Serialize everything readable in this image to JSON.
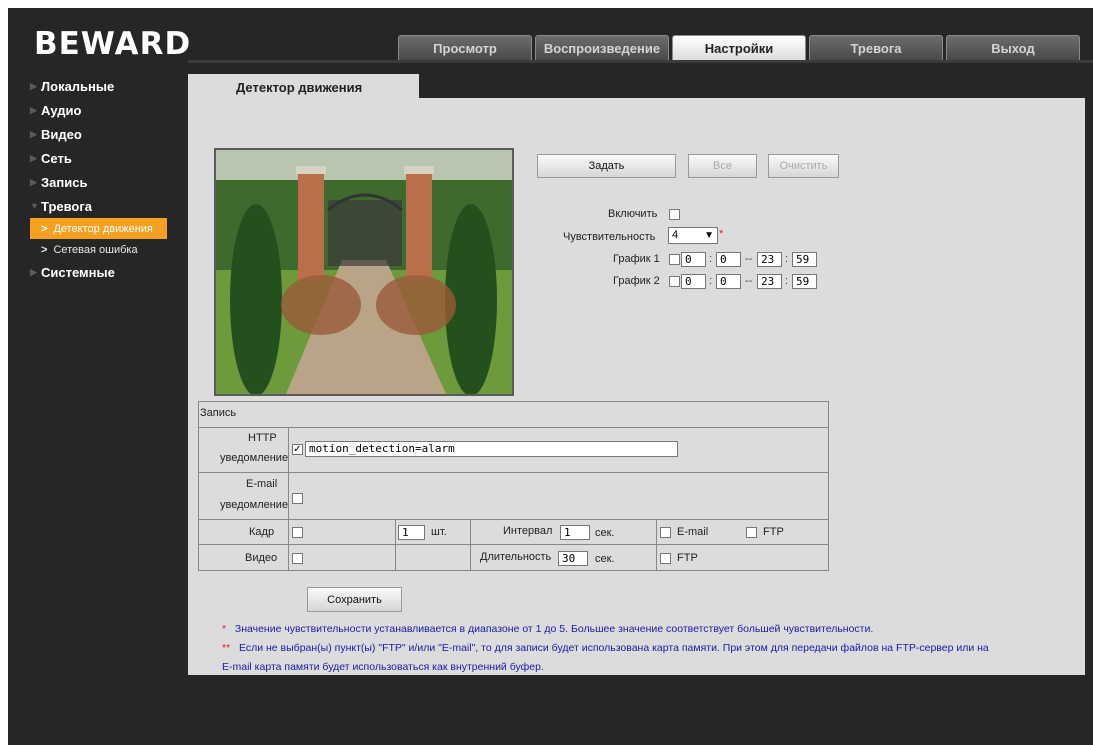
{
  "brand": "BEWARD",
  "tabs": [
    "Просмотр",
    "Воспроизведение",
    "Настройки",
    "Тревога",
    "Выход"
  ],
  "active_tab": 2,
  "sidebar": {
    "items": [
      {
        "label": "Локальные"
      },
      {
        "label": "Аудио"
      },
      {
        "label": "Видео"
      },
      {
        "label": "Сеть"
      },
      {
        "label": "Запись"
      },
      {
        "label": "Тревога",
        "expanded": true
      },
      {
        "label": "Системные"
      }
    ],
    "subitems": [
      {
        "label": "Детектор движения",
        "active": true
      },
      {
        "label": "Сетевая ошибка"
      }
    ]
  },
  "content_tab": "Детектор движения",
  "buttons": {
    "set": "Задать",
    "all": "Все",
    "clear": "Очистить",
    "save": "Сохранить"
  },
  "settings": {
    "enable_label": "Включить",
    "sensitivity_label": "Чувствительность",
    "sensitivity_value": "4",
    "schedule1_label": "График 1",
    "schedule1": {
      "h1": "0",
      "m1": "0",
      "h2": "23",
      "m2": "59"
    },
    "schedule2_label": "График 2",
    "schedule2": {
      "h1": "0",
      "m1": "0",
      "h2": "23",
      "m2": "59"
    }
  },
  "record": {
    "title": "Запись",
    "http_label_1": "HTTP",
    "http_label_2": "уведомление",
    "http_value": "motion_detection=alarm",
    "email_label_1": "E-mail",
    "email_label_2": "уведомление",
    "frame_label": "Кадр",
    "frame_count": "1",
    "frame_unit": "шт.",
    "interval_label": "Интервал",
    "interval_value": "1",
    "sec": "сек.",
    "email": "E-mail",
    "ftp": "FTP",
    "video_label": "Видео",
    "duration_label": "Длительность",
    "duration_value": "30"
  },
  "notes": {
    "note1_star": "*",
    "note1": "Значение чувствительности устанавливается в диапазоне от 1 до 5. Большее значение соответствует большей чувствительности.",
    "note2_star": "**",
    "note2_line1": "Если не выбран(ы) пункт(ы) \"FTP\" и/или \"E-mail\", то для записи будет использована карта памяти. При этом для передачи файлов на FTP-сервер или на",
    "note2_line2": "E-mail карта памяти будет использоваться как внутренний буфер."
  },
  "colors": {
    "accent": "#f5a020",
    "background": "#262626",
    "panel": "#dcdcdc",
    "note_text": "#1a1aa8",
    "asterisk": "#e02020"
  }
}
